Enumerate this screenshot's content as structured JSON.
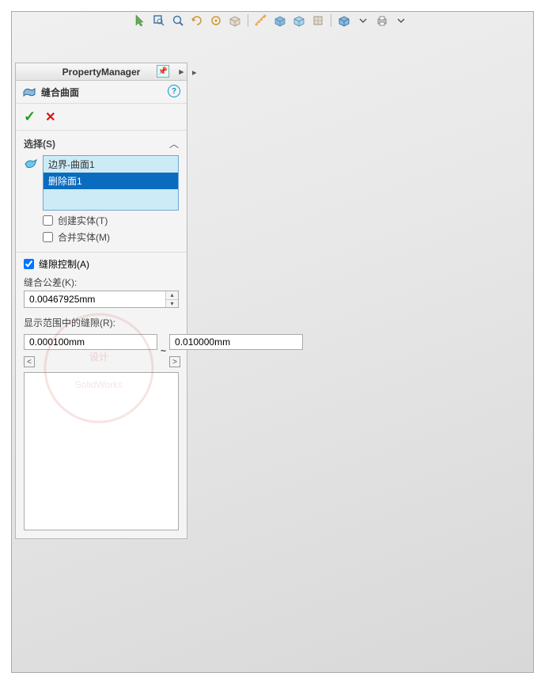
{
  "panel": {
    "title": "PropertyManager",
    "feature_title": "缝合曲面",
    "help_symbol": "?"
  },
  "toolbar": {
    "icons": [
      "cursor",
      "rect-zoom",
      "zoom",
      "rotate",
      "pan",
      "section",
      "measure",
      "toggle",
      "display",
      "appearance",
      "settings",
      "dropdown",
      "cube",
      "print"
    ]
  },
  "confirm": {
    "ok": "✓",
    "cancel": "✕"
  },
  "sections": {
    "selection": {
      "title": "选择(S)",
      "items": [
        "边界-曲面1",
        "删除面1"
      ],
      "selected_index": 1,
      "create_solid": "创建实体(T)",
      "merge_entities": "合并实体(M)"
    },
    "gap": {
      "title": "缝隙控制(A)",
      "tolerance_label": "缝合公差(K):",
      "tolerance_value": "0.00467925mm",
      "range_label": "显示范围中的缝隙(R):",
      "range_min": "0.000100mm",
      "range_max": "0.010000mm"
    }
  }
}
